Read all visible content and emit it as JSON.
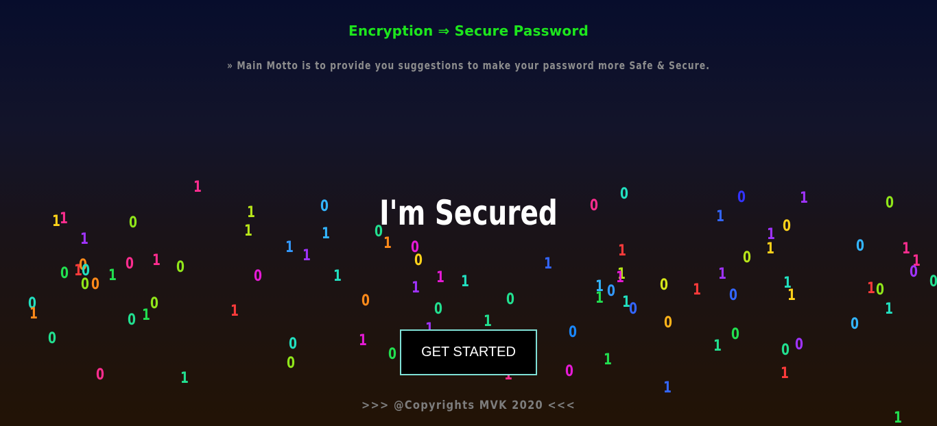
{
  "header": {
    "title": "Encryption ⇒ Secure Password",
    "motto": "» Main Motto is to provide you suggestions to make your password more Safe & Secure."
  },
  "hero": {
    "title": "I'm Secured",
    "cta_label": "GET STARTED"
  },
  "footer": {
    "text": ">>> @Copyrights MVK 2020 <<<"
  },
  "colors": {
    "title_green": "#1de61d",
    "cta_border": "#7fe0d6",
    "background_top": "#070d2c",
    "background_bottom": "#221305"
  },
  "binary_rain": [
    "1",
    "1",
    "1",
    "0",
    "1",
    "1",
    "0",
    "1",
    "0",
    "1",
    "0",
    "0",
    "1",
    "1",
    "0",
    "1",
    "1",
    "0",
    "1",
    "0",
    "0",
    "1",
    "0",
    "0",
    "0",
    "1",
    "0",
    "0",
    "1",
    "0",
    "1",
    "0",
    "1",
    "0",
    "0",
    "1",
    "0",
    "0",
    "1",
    "0",
    "1",
    "1",
    "1",
    "0",
    "0",
    "1",
    "1",
    "0",
    "1",
    "1",
    "0",
    "0",
    "1",
    "0",
    "0",
    "1",
    "1",
    "1",
    "1",
    "0",
    "1",
    "1",
    "0",
    "0",
    "1",
    "0",
    "1",
    "1",
    "0",
    "1",
    "0",
    "1",
    "0",
    "1",
    "0",
    "1",
    "1",
    "1",
    "0",
    "1",
    "0",
    "0",
    "1",
    "0",
    "0",
    "1",
    "1",
    "0",
    "0",
    "1",
    "0",
    "1",
    "0",
    "1",
    "0",
    "1",
    "0",
    "1"
  ]
}
